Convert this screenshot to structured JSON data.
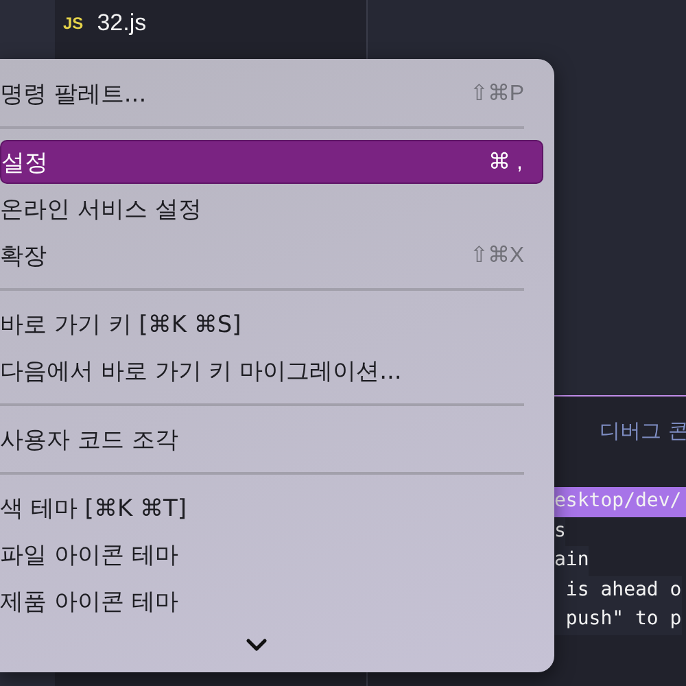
{
  "explorer": {
    "files": [
      {
        "name": "32.js",
        "badge": "JS"
      }
    ]
  },
  "panel": {
    "tab": "디버그 콘"
  },
  "terminal": {
    "path": "esktop/dev/",
    "lines": [
      "s",
      "ain",
      " is ahead o",
      " push\" to p"
    ]
  },
  "menu": {
    "items": [
      {
        "kind": "item",
        "label": "명령 팔레트...",
        "shortcut": "⇧⌘P",
        "selected": false
      },
      {
        "kind": "separator"
      },
      {
        "kind": "item",
        "label": "설정",
        "shortcut": "⌘ ,",
        "selected": true
      },
      {
        "kind": "item",
        "label": "온라인 서비스 설정",
        "selected": false
      },
      {
        "kind": "item",
        "label": "확장",
        "shortcut": "⇧⌘X",
        "selected": false
      },
      {
        "kind": "separator"
      },
      {
        "kind": "item",
        "label": "바로 가기 키 [⌘K ⌘S]",
        "selected": false
      },
      {
        "kind": "item",
        "label": "다음에서 바로 가기 키 마이그레이션...",
        "selected": false
      },
      {
        "kind": "separator"
      },
      {
        "kind": "item",
        "label": "사용자 코드 조각",
        "selected": false
      },
      {
        "kind": "separator"
      },
      {
        "kind": "item",
        "label": "색 테마 [⌘K ⌘T]",
        "selected": false
      },
      {
        "kind": "item",
        "label": "파일 아이콘 테마",
        "selected": false
      },
      {
        "kind": "item",
        "label": "제품 아이콘 테마",
        "selected": false
      }
    ],
    "more": true
  }
}
